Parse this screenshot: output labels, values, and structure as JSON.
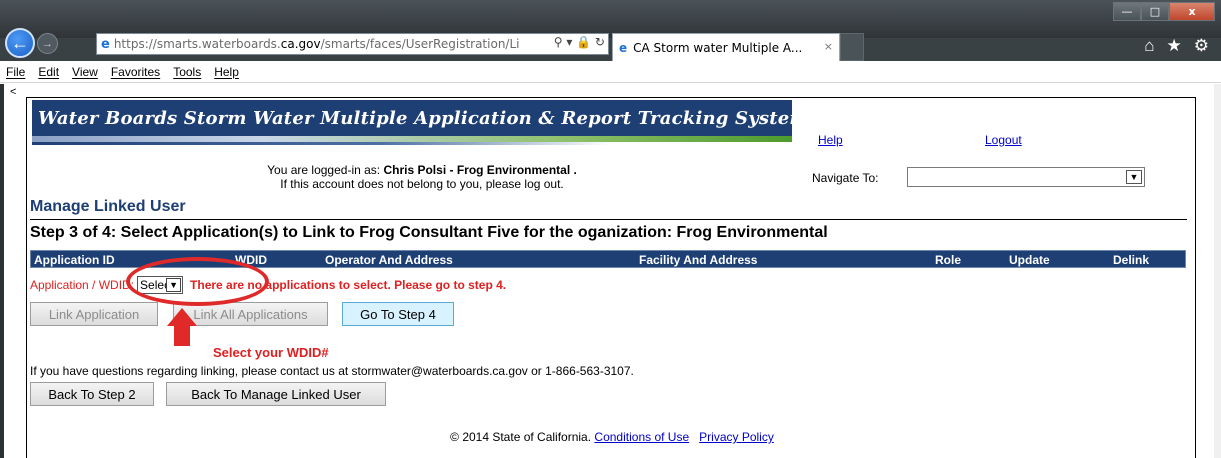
{
  "window": {
    "minimize_glyph": "—",
    "maximize_glyph": "□",
    "close_glyph": "x"
  },
  "browser": {
    "back_glyph": "←",
    "forward_glyph": "→",
    "url_prefix": "https://smarts.waterboards.",
    "url_host": "ca.gov",
    "url_suffix": "/smarts/faces/UserRegistration/Li",
    "address_tools": "⚲ ▾ 🔒 ↻",
    "tab_title": "CA Storm water Multiple A...",
    "tab_close": "×",
    "icons": [
      "home-icon",
      "favorites-star-icon",
      "settings-gear-icon"
    ]
  },
  "menubar": [
    "File",
    "Edit",
    "View",
    "Favorites",
    "Tools",
    "Help"
  ],
  "page": {
    "left_mark": "<",
    "banner_title": "Water Boards  Storm Water Multiple Application & Report Tracking System",
    "help_link": "Help",
    "logout_link": "Logout",
    "logged_in_prefix": "You are logged-in as: ",
    "logged_in_user": "Chris Polsi - Frog Environmental .",
    "logged_in_note": "If this account does not belong to you, please log out.",
    "navigate_label": "Navigate To:",
    "navigate_value": "",
    "manage_title": "Manage Linked User",
    "step_title": "Step 3 of 4: Select Application(s) to Link to Frog Consultant Five for the oganization: Frog Environmental",
    "grid_headers": [
      "Application ID",
      "WDID",
      "Operator And Address",
      "Facility And Address",
      "Role",
      "Update",
      "Delink"
    ],
    "wdid_label": "Application / WDID:",
    "wdid_select_value": "Select",
    "no_apps_message": "There are no applications to select. Please go to step 4.",
    "buttons": {
      "link_application": "Link Application",
      "link_all_applications": "Link All Applications",
      "go_to_step4": "Go To Step 4",
      "back_to_step2": "Back To Step 2",
      "back_to_manage": "Back To Manage Linked User"
    },
    "hint_text": "Select your WDID#",
    "contact_text": "If you have questions regarding linking, please contact us at stormwater@waterboards.ca.gov or 1-866-563-3107.",
    "footer_copyright": "© 2014 State of California.",
    "footer_links": [
      "Conditions of Use",
      "Privacy Policy"
    ]
  },
  "colors": {
    "banner_navy": "#1e3f74",
    "error_red": "#e02020",
    "link_blue": "#0000cc",
    "primary_button": "#d8f3ff"
  }
}
